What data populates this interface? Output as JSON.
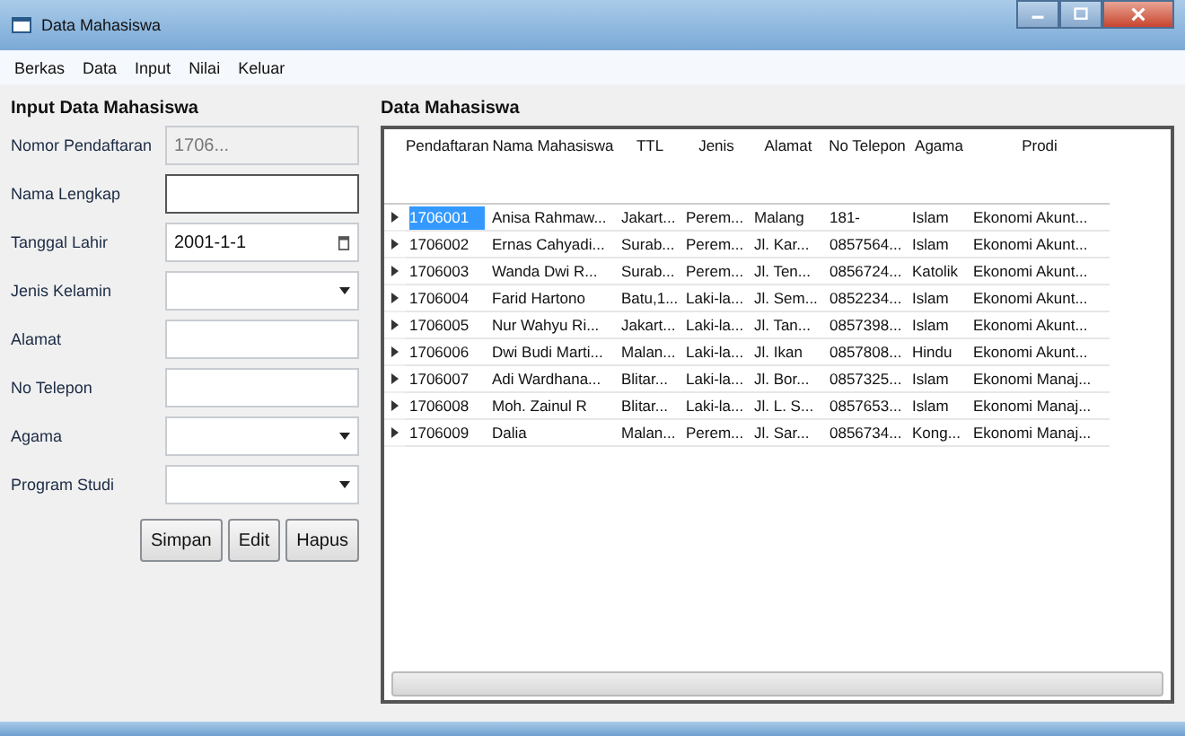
{
  "window": {
    "title": "Data Mahasiswa"
  },
  "menu": [
    "Berkas",
    "Data",
    "Input",
    "Nilai",
    "Keluar"
  ],
  "form": {
    "title": "Input Data Mahasiswa",
    "fields": [
      {
        "label": "Nomor Pendaftaran",
        "kind": "text",
        "value": "1706...",
        "disabled": true
      },
      {
        "label": "Nama Lengkap",
        "kind": "text",
        "focused": true,
        "disabled": false
      },
      {
        "label": "Tanggal Lahir",
        "kind": "date",
        "value": "2001-1-1",
        "disabled": false
      },
      {
        "label": "Jenis Kelamin",
        "kind": "combo",
        "disabled": false
      },
      {
        "label": "Alamat",
        "kind": "text",
        "disabled": false
      },
      {
        "label": "No Telepon",
        "kind": "text",
        "disabled": false
      },
      {
        "label": "Agama",
        "kind": "combo",
        "disabled": false
      },
      {
        "label": "Program Studi",
        "kind": "combo",
        "disabled": false
      }
    ],
    "buttons": [
      "Simpan",
      "Edit",
      "Hapus"
    ]
  },
  "table": {
    "title": "Data Mahasiswa",
    "columns": [
      "Pendaftaran",
      "Nama Mahasiswa",
      "TTL",
      "Jenis",
      "Alamat",
      "No Telepon",
      "Agama",
      "Prodi"
    ],
    "rows": [
      {
        "selected": true,
        "cells": [
          "1706001",
          "Anisa Rahmaw...",
          "Jakart...",
          "Perem...",
          "Malang",
          "181-",
          "Islam",
          "Ekonomi Akunt..."
        ]
      },
      {
        "selected": false,
        "cells": [
          "1706002",
          "Ernas Cahyadi...",
          "Surab...",
          "Perem...",
          "Jl. Kar...",
          "0857564...",
          "Islam",
          "Ekonomi Akunt..."
        ]
      },
      {
        "selected": false,
        "cells": [
          "1706003",
          "Wanda Dwi R...",
          "Surab...",
          "Perem...",
          "Jl. Ten...",
          "0856724...",
          "Katolik",
          "Ekonomi Akunt..."
        ]
      },
      {
        "selected": false,
        "cells": [
          "1706004",
          "Farid Hartono",
          "Batu,1...",
          "Laki-la...",
          "Jl. Sem...",
          "0852234...",
          "Islam",
          "Ekonomi Akunt..."
        ]
      },
      {
        "selected": false,
        "cells": [
          "1706005",
          "Nur Wahyu Ri...",
          "Jakart...",
          "Laki-la...",
          "Jl. Tan...",
          "0857398...",
          "Islam",
          "Ekonomi Akunt..."
        ]
      },
      {
        "selected": false,
        "cells": [
          "1706006",
          "Dwi Budi Marti...",
          "Malan...",
          "Laki-la...",
          "Jl. Ikan",
          "0857808...",
          "Hindu",
          "Ekonomi Akunt..."
        ]
      },
      {
        "selected": false,
        "cells": [
          "1706007",
          "Adi Wardhana...",
          "Blitar...",
          "Laki-la...",
          "Jl. Bor...",
          "0857325...",
          "Islam",
          "Ekonomi Manaj..."
        ]
      },
      {
        "selected": false,
        "cells": [
          "1706008",
          "Moh. Zainul R",
          "Blitar...",
          "Laki-la...",
          "Jl. L. S...",
          "0857653...",
          "Islam",
          "Ekonomi Manaj..."
        ]
      },
      {
        "selected": false,
        "cells": [
          "1706009",
          "Dalia",
          "Malan...",
          "Perem...",
          "Jl. Sar...",
          "0856734...",
          "Kong...",
          "Ekonomi Manaj..."
        ]
      }
    ]
  }
}
